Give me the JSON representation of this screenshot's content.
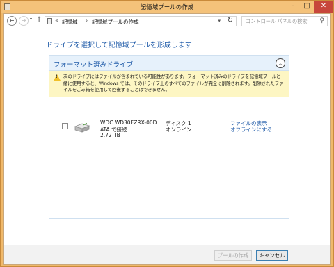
{
  "window": {
    "title": "記憶域プールの作成",
    "min_glyph": "–",
    "max_glyph": "□",
    "close_glyph": "✕"
  },
  "addressbar": {
    "back_glyph": "←",
    "forward_glyph": "→",
    "dropdown_glyph": "▾",
    "up_glyph": "↑",
    "sep1": "«",
    "crumb1": "記憶域",
    "sep2": "›",
    "crumb2": "記憶域プールの作成",
    "chevron": "▾",
    "refresh_glyph": "↻",
    "search_placeholder": "コントロール パネルの検索",
    "search_glyph": "⚲"
  },
  "main": {
    "heading": "ドライブを選択して記憶域プールを形成します",
    "section": {
      "title": "フォーマット済みドライブ",
      "collapse_glyph": "︿",
      "warning_mark": "!",
      "warning_text": "次のドライブにはファイルが含まれている可能性があります。フォーマット済みのドライブを記憶域プールと一緒に使用すると、Windows では、そのドライブ上のすべてのファイルが完全に削除されます。削除されたファイルをごみ箱を使用して回復することはできません。"
    },
    "drive": {
      "name": "WDC WD30EZRX-00D...",
      "connection": "ATA で接続",
      "size": "2.72 TB",
      "disk": "ディスク 1",
      "status": "オンライン",
      "link_show_files": "ファイルの表示",
      "link_offline": "オフラインにする"
    }
  },
  "footer": {
    "create_label": "プールの作成",
    "cancel_label": "キャンセル"
  }
}
